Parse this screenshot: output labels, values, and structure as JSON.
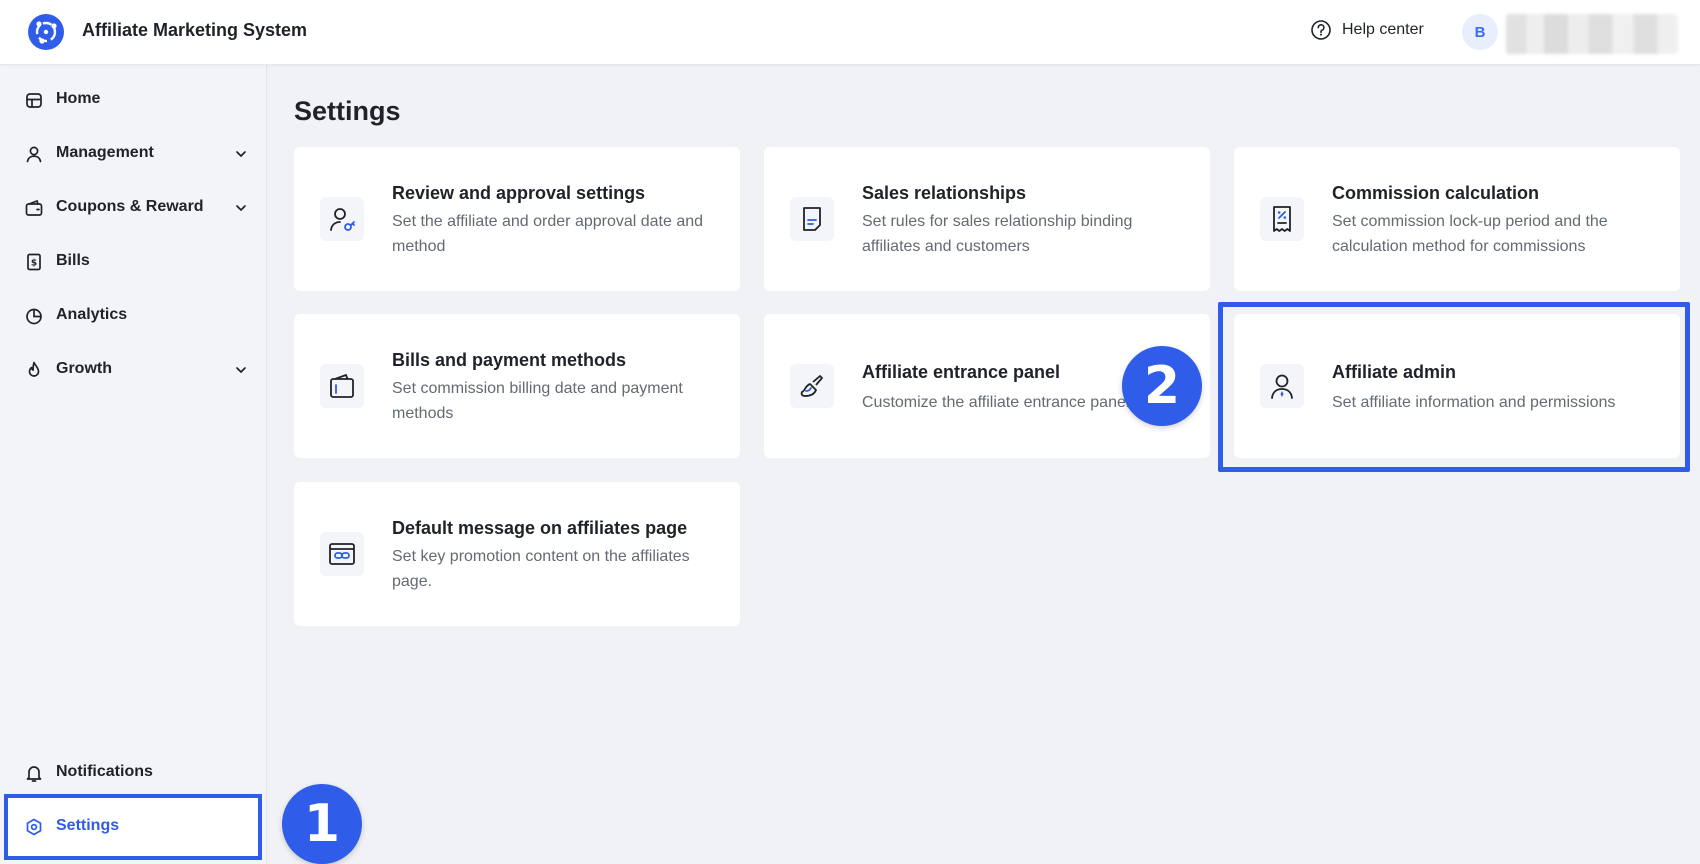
{
  "header": {
    "app_title": "Affiliate Marketing System",
    "help_label": "Help center",
    "avatar_initial": "B"
  },
  "sidebar": {
    "items": [
      {
        "label": "Home",
        "icon": "home-icon"
      },
      {
        "label": "Management",
        "icon": "user-icon",
        "expandable": true
      },
      {
        "label": "Coupons & Reward",
        "icon": "wallet-icon",
        "expandable": true
      },
      {
        "label": "Bills",
        "icon": "bill-icon"
      },
      {
        "label": "Analytics",
        "icon": "pie-chart-icon"
      },
      {
        "label": "Growth",
        "icon": "flame-icon",
        "expandable": true
      }
    ],
    "bottom_items": [
      {
        "label": "Notifications",
        "icon": "bell-icon"
      },
      {
        "label": "Settings",
        "icon": "settings-icon",
        "active": true
      }
    ]
  },
  "main": {
    "title": "Settings",
    "cards": [
      {
        "title": "Review and approval settings",
        "desc": "Set the affiliate and order approval date and method",
        "icon": "user-check-icon"
      },
      {
        "title": "Sales relationships",
        "desc": "Set rules for sales relationship binding affiliates and customers",
        "icon": "document-icon"
      },
      {
        "title": "Commission calculation",
        "desc": "Set commission lock-up period and the calculation method for commissions",
        "icon": "receipt-percent-icon"
      },
      {
        "title": "Bills and payment methods",
        "desc": "Set commission billing date and payment methods",
        "icon": "wallet-icon"
      },
      {
        "title": "Affiliate entrance panel",
        "desc": "Customize the affiliate entrance panel",
        "icon": "brush-icon"
      },
      {
        "title": "Affiliate admin",
        "desc": "Set affiliate information and permissions",
        "icon": "user-admin-icon"
      },
      {
        "title": "Default message on affiliates page",
        "desc": "Set key promotion content on the affiliates page.",
        "icon": "link-window-icon"
      }
    ]
  },
  "annotations": {
    "step1": "1",
    "step2": "2"
  },
  "colors": {
    "accent": "#2f5ce8",
    "background": "#f1f2f5",
    "card": "#ffffff",
    "text": "#1f2329",
    "muted_text": "#646a73"
  }
}
